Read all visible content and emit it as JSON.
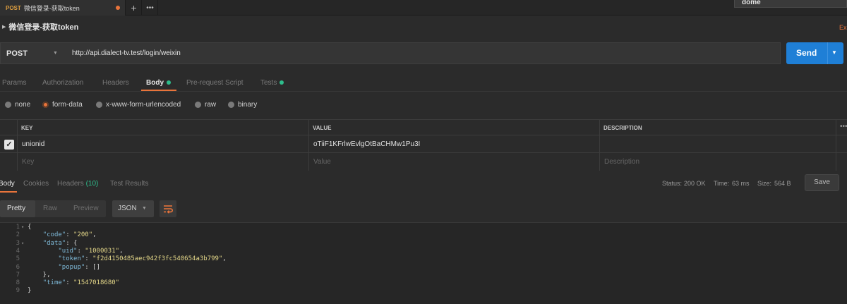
{
  "tab": {
    "method": "POST",
    "name": "微信登录-获取token"
  },
  "environment": {
    "name": "dome"
  },
  "request": {
    "title": "微信登录-获取token",
    "edge_text": "Ex",
    "method": "POST",
    "url": "http://api.dialect-tv.test/login/weixin",
    "send_label": "Send"
  },
  "request_tabs": [
    "Params",
    "Authorization",
    "Headers",
    "Body",
    "Pre-request Script",
    "Tests"
  ],
  "body_types": [
    "none",
    "form-data",
    "x-www-form-urlencoded",
    "raw",
    "binary"
  ],
  "body_type_selected": "form-data",
  "params_table": {
    "headers": [
      "KEY",
      "VALUE",
      "DESCRIPTION"
    ],
    "more": "•••",
    "rows": [
      {
        "checked": true,
        "key": "unionid",
        "value": "oTiiF1KFrlwEvlgOtBaCHMw1Pu3I",
        "description": ""
      }
    ],
    "placeholders": {
      "key": "Key",
      "value": "Value",
      "description": "Description"
    }
  },
  "response_tabs": {
    "body": "Body",
    "cookies": "Cookies",
    "headers": "Headers",
    "headers_count": "(10)",
    "test_results": "Test Results"
  },
  "status": {
    "status_label": "Status:",
    "status_value": "200 OK",
    "time_label": "Time:",
    "time_value": "63 ms",
    "size_label": "Size:",
    "size_value": "564 B"
  },
  "save_label": "Save",
  "viewer": {
    "modes": [
      "Pretty",
      "Raw",
      "Preview"
    ],
    "format": "JSON"
  },
  "response_lines": [
    "{",
    "    \"code\": \"200\",",
    "    \"data\": {",
    "        \"uid\": \"1000031\",",
    "        \"token\": \"f2d4150485aec942f3fc540654a3b799\",",
    "        \"popup\": []",
    "    },",
    "    \"time\": \"1547018680\"",
    "}"
  ],
  "colors": {
    "accent": "#e8743b",
    "send": "#1f7fd6",
    "success": "#2ebd8c"
  }
}
